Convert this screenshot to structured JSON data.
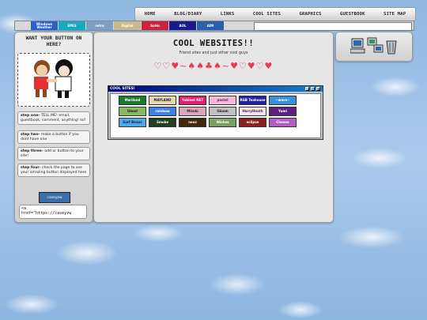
{
  "nav": [
    "HOME",
    "BLOG/DIARY",
    "LINKS",
    "COOL SITES",
    "GRAPHICS",
    "GUESTBOOK",
    "SITE MAP"
  ],
  "buttonbar": [
    {
      "label": "Windows Weather",
      "bg": "#2a62c9"
    },
    {
      "label": "EPES",
      "bg": "#18a8c0"
    },
    {
      "label": "retro",
      "bg": "#7aa0c8"
    },
    {
      "label": "Digital",
      "bg": "#c8b890"
    },
    {
      "label": "SoHo",
      "bg": "#d02040"
    },
    {
      "label": "AOL",
      "bg": "#1a1a8a"
    },
    {
      "label": "AIM",
      "bg": "#2a5fb0"
    }
  ],
  "left": {
    "title": "WANT YOUR BUTTON ON HERE?",
    "steps": [
      {
        "label": "step one-",
        "text": "TELL ME! email, guestbook, comment, anything! lol!"
      },
      {
        "label": "step two-",
        "text": "make a button if you dont have one"
      },
      {
        "label": "step three-",
        "text": "add ur button to your site!"
      },
      {
        "label": "step four-",
        "text": "check the page to see your amazing button displayed here"
      }
    ],
    "my_button": "caseyzw",
    "code_snippet": "<a\nhref=\"https://caseyzw"
  },
  "main": {
    "title": "COOL WEBSITES!!",
    "subtitle": "Friend sites and just other cool guys",
    "hearts": "♡♡♥~♠♠♣♠~♥♡♥♡♥"
  },
  "window": {
    "title": "COOL SITES!",
    "sites": [
      {
        "label": "Mariland",
        "bg": "#1b7a2c"
      },
      {
        "label": "MAYLAND",
        "bg": "#e6d8a8",
        "fg": "#1a1a5a"
      },
      {
        "label": "Yukinet NET",
        "bg": "#e02070"
      },
      {
        "label": "pastel",
        "bg": "#f4b8d8",
        "fg": "#503050"
      },
      {
        "label": "RGB Teahouse",
        "bg": "#2020a0"
      },
      {
        "label": "~wave~",
        "bg": "#3a90d8"
      },
      {
        "label": "Ghost",
        "bg": "#88b860",
        "fg": "#102010"
      },
      {
        "label": "rainbow",
        "bg": "#4080e0"
      },
      {
        "label": "Mizuki",
        "bg": "#d8a8b8",
        "fg": "#402030"
      },
      {
        "label": "Gloom",
        "bg": "#c0c0c0",
        "fg": "#202020"
      },
      {
        "label": "HarryHeath",
        "bg": "#f6e6f0",
        "fg": "#602040"
      },
      {
        "label": "Yumi",
        "bg": "#602080"
      },
      {
        "label": "Surf Beaus",
        "bg": "#50a8e8",
        "fg": "#102050"
      },
      {
        "label": "Smoke",
        "bg": "#204020"
      },
      {
        "label": "neoz",
        "bg": "#402810"
      },
      {
        "label": "Wishes",
        "bg": "#78a060"
      },
      {
        "label": "eclipse",
        "bg": "#8a2020"
      },
      {
        "label": "Cheese",
        "bg": "#b060c0"
      }
    ]
  }
}
